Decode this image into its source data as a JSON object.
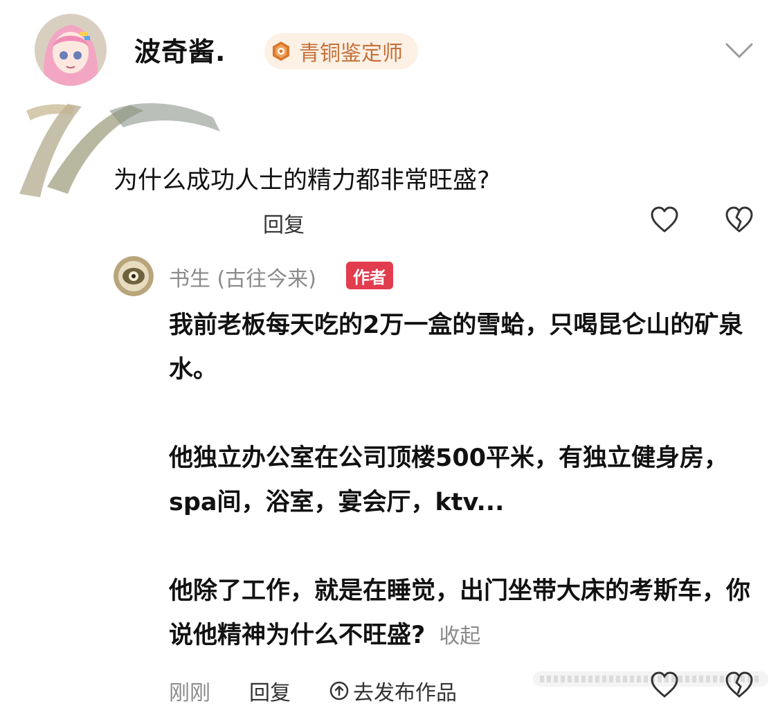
{
  "comment": {
    "username": "波奇酱.",
    "badge": {
      "label": "青铜鉴定师",
      "icon": "medal-icon",
      "color": "#c4713a"
    },
    "text": "为什么成功人士的精力都非常旺盛?",
    "reply_label": "回复",
    "icons": {
      "like": "heart-icon",
      "dislike": "broken-heart-icon",
      "collapse": "chevron-down-icon"
    }
  },
  "reply": {
    "username": "书生 (古往今来)",
    "author_tag": "作者",
    "paragraphs": [
      "我前老板每天吃的2万一盒的雪蛤，只喝昆仑山的矿泉水。",
      "他独立办公室在公司顶楼500平米，有独立健身房，spa间，浴室，宴会厅，ktv...",
      "他除了工作，就是在睡觉，出门坐带大床的考斯车，你说他精神为什么不旺盛?"
    ],
    "collapse_label": "收起",
    "time": "刚刚",
    "reply_label": "回复",
    "publish_label": "去发布作品"
  },
  "colors": {
    "author_tag": "#e23c4f",
    "badge_bg": "#fdf0e4",
    "muted_text": "#8a8a8a"
  }
}
